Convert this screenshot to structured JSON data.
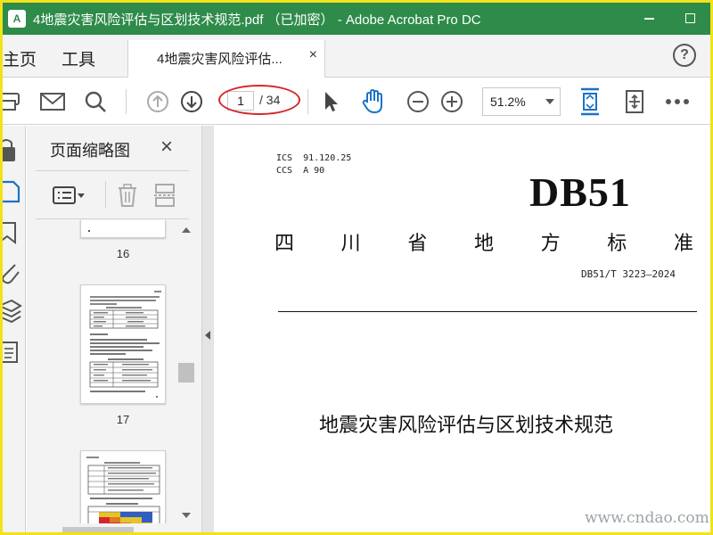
{
  "window": {
    "title": "4地震灾害风险评估与区划技术规范.pdf （已加密） - Adobe Acrobat Pro DC",
    "logo_text": "A",
    "minimize_icon": "minimize-icon",
    "maximize_icon": "maximize-icon"
  },
  "tabs": {
    "home": "主页",
    "tools": "工具",
    "document_tab": "4地震灾害风险评估...",
    "close_glyph": "×",
    "help_glyph": "?"
  },
  "toolbar": {
    "icons": [
      "print-icon",
      "email-icon",
      "search-icon",
      "prev-page-icon",
      "next-page-icon",
      "select-cursor-icon",
      "hand-tool-icon",
      "zoom-out-icon",
      "zoom-in-icon",
      "fit-page-icon",
      "scroll-mode-icon",
      "more-icon"
    ],
    "current_page": "1",
    "total_pages": "/ 34",
    "zoom": "51.2%"
  },
  "panel": {
    "title": "页面缩略图",
    "close_glyph": "×",
    "thumbnails": [
      {
        "number": "16"
      },
      {
        "number": "17"
      },
      {
        "number": ""
      }
    ]
  },
  "document": {
    "ics_line": "ICS  91.120.25",
    "ccs_line": "CCS  A 90",
    "db_code": "DB51",
    "province_chars": [
      "四",
      "川",
      "省",
      "地",
      "方",
      "标",
      "准"
    ],
    "standard_number": "DB51/T 3223—2024",
    "title": "地震灾害风险评估与区划技术规范"
  },
  "watermark": "www.cndao.com",
  "colors": {
    "titlebar": "#2e8b4a",
    "frame": "#f2e21a",
    "annotation_oval": "#d7262a",
    "active_icon": "#1a73c8"
  }
}
